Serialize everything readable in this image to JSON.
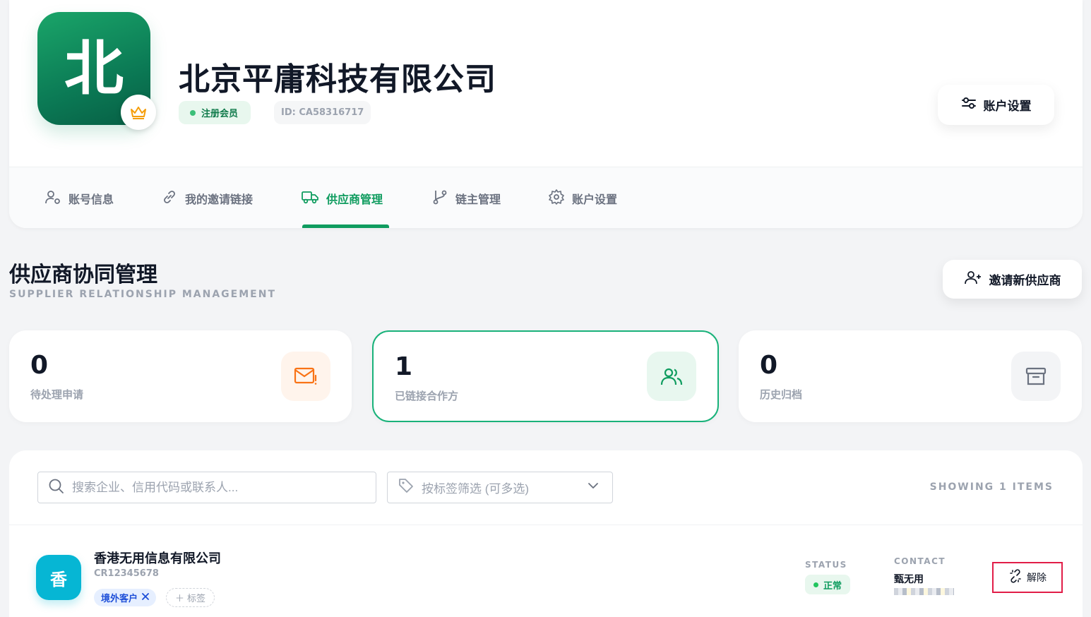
{
  "profile": {
    "avatar_char": "北",
    "company_name": "北京平庸科技有限公司",
    "member_badge": "注册会员",
    "id_label": "ID: CA58316717",
    "settings_button": "账户设置",
    "icons": {
      "crown": "crown-icon",
      "settings": "sliders-icon"
    }
  },
  "tabs": [
    {
      "label": "账号信息",
      "icon": "user-gear-icon",
      "active": false
    },
    {
      "label": "我的邀请链接",
      "icon": "link-icon",
      "active": false
    },
    {
      "label": "供应商管理",
      "icon": "truck-icon",
      "active": true
    },
    {
      "label": "链主管理",
      "icon": "branch-icon",
      "active": false
    },
    {
      "label": "账户设置",
      "icon": "gear-icon",
      "active": false
    }
  ],
  "section": {
    "title": "供应商协同管理",
    "subtitle": "SUPPLIER RELATIONSHIP MANAGEMENT",
    "invite_button": "邀请新供应商"
  },
  "stats": [
    {
      "value": "0",
      "label": "待处理申请",
      "icon": "mail-alert-icon",
      "color": "#f97316"
    },
    {
      "value": "1",
      "label": "已链接合作方",
      "icon": "users-icon",
      "color": "#0f9c5f"
    },
    {
      "value": "0",
      "label": "历史归档",
      "icon": "archive-icon",
      "color": "#6b7280"
    }
  ],
  "list": {
    "search_placeholder": "搜索企业、信用代码或联系人...",
    "tag_filter_placeholder": "按标签筛选 (可多选)",
    "showing": "SHOWING 1 ITEMS",
    "rows": [
      {
        "avatar_char": "香",
        "name": "香港无用信息有限公司",
        "code": "CR12345678",
        "tags": [
          "境外客户"
        ],
        "add_tag_label": "标签",
        "status_label": "STATUS",
        "status": "正常",
        "contact_label": "CONTACT",
        "contact_name": "甄无用",
        "unlink_label": "解除"
      }
    ]
  },
  "colors": {
    "accent": "#0f9c5f",
    "unlink_border": "#e11d48",
    "tag_blue": "#1d4ed8"
  }
}
